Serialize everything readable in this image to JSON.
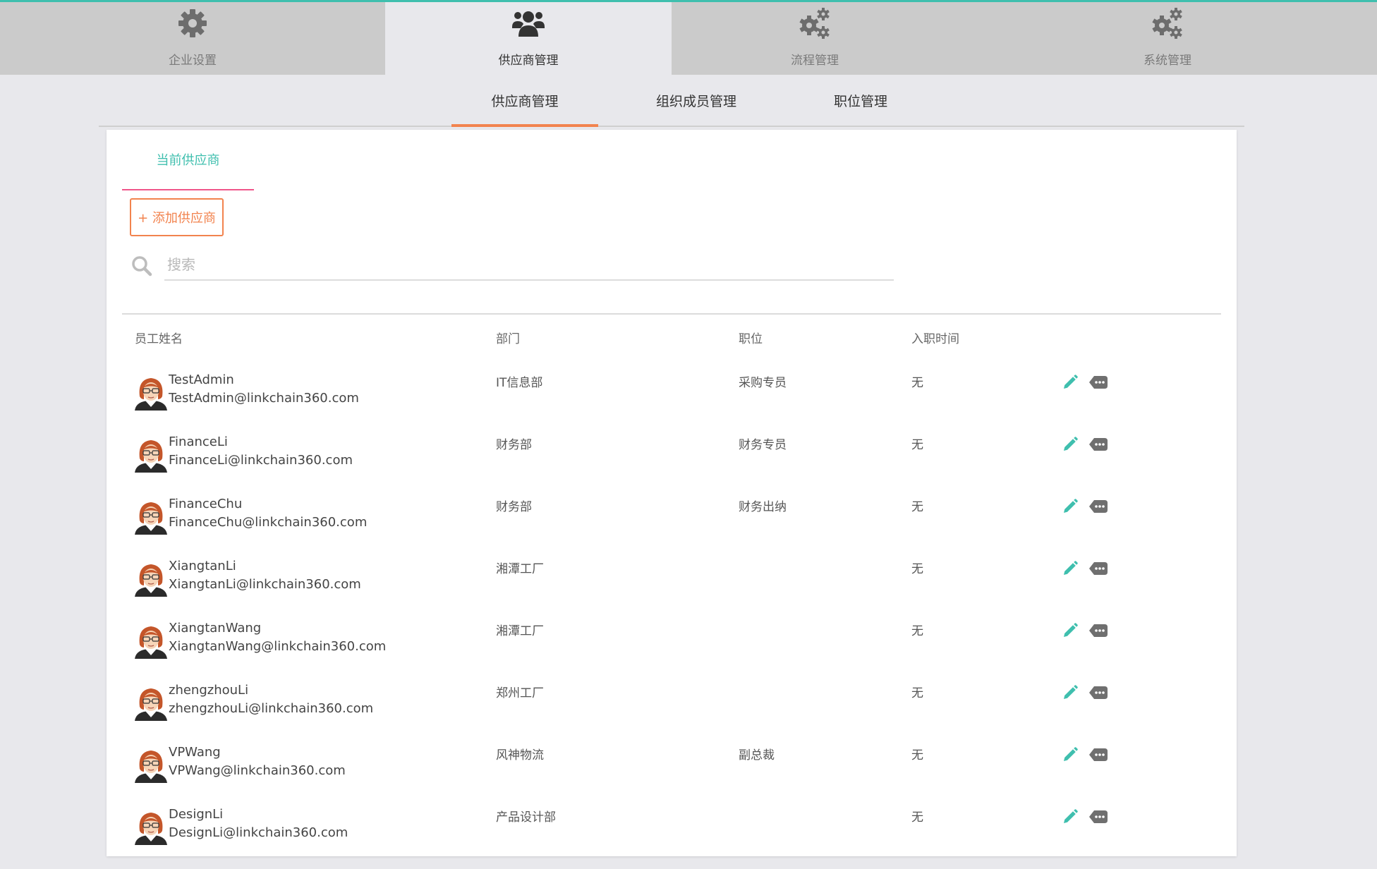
{
  "top_nav": {
    "tabs": [
      {
        "label": "企业设置",
        "icon": "gear-icon"
      },
      {
        "label": "供应商管理",
        "icon": "users-icon",
        "active": true
      },
      {
        "label": "流程管理",
        "icon": "gears-icon"
      },
      {
        "label": "系统管理",
        "icon": "gears-icon"
      }
    ]
  },
  "sub_nav": {
    "tabs": [
      {
        "label": "供应商管理",
        "active": true
      },
      {
        "label": "组织成员管理"
      },
      {
        "label": "职位管理"
      }
    ]
  },
  "panel": {
    "current_tab": "当前供应商",
    "add_button": "+ 添加供应商",
    "search_placeholder": "搜索"
  },
  "table": {
    "headers": [
      "员工姓名",
      "部门",
      "职位",
      "入职时间"
    ],
    "rows": [
      {
        "name": "TestAdmin",
        "email": "TestAdmin@linkchain360.com",
        "dept": "IT信息部",
        "position": "采购专员",
        "join": "无"
      },
      {
        "name": "FinanceLi",
        "email": "FinanceLi@linkchain360.com",
        "dept": "财务部",
        "position": "财务专员",
        "join": "无"
      },
      {
        "name": "FinanceChu",
        "email": "FinanceChu@linkchain360.com",
        "dept": "财务部",
        "position": "财务出纳",
        "join": "无"
      },
      {
        "name": "XiangtanLi",
        "email": "XiangtanLi@linkchain360.com",
        "dept": "湘潭工厂",
        "position": "",
        "join": "无"
      },
      {
        "name": "XiangtanWang",
        "email": "XiangtanWang@linkchain360.com",
        "dept": "湘潭工厂",
        "position": "",
        "join": "无"
      },
      {
        "name": "zhengzhouLi",
        "email": "zhengzhouLi@linkchain360.com",
        "dept": "郑州工厂",
        "position": "",
        "join": "无"
      },
      {
        "name": "VPWang",
        "email": "VPWang@linkchain360.com",
        "dept": "风神物流",
        "position": "副总裁",
        "join": "无"
      },
      {
        "name": "DesignLi",
        "email": "DesignLi@linkchain360.com",
        "dept": "产品设计部",
        "position": "",
        "join": "无"
      }
    ]
  },
  "colors": {
    "accent_teal": "#3fbfae",
    "accent_orange": "#f2834e",
    "accent_pink": "#f0558a"
  }
}
